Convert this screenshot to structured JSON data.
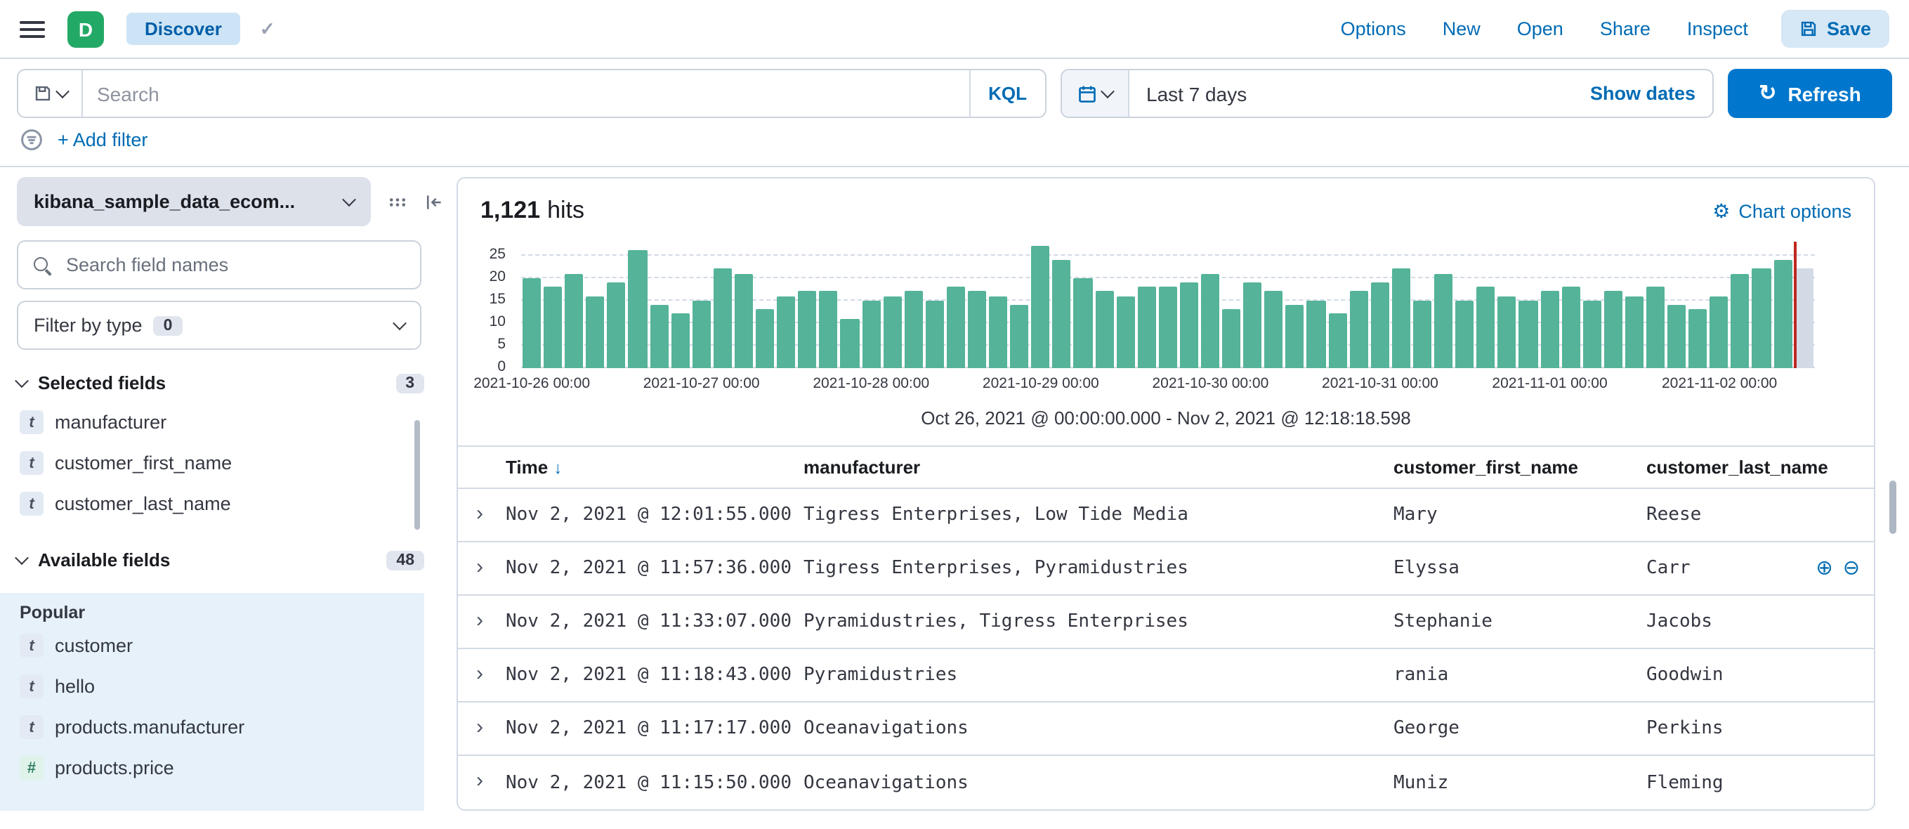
{
  "header": {
    "logo_letter": "D",
    "breadcrumb": "Discover",
    "nav_links": [
      "Options",
      "New",
      "Open",
      "Share",
      "Inspect"
    ],
    "save_label": "Save"
  },
  "search_bar": {
    "placeholder": "Search",
    "kql_label": "KQL",
    "time_range": "Last 7 days",
    "show_dates_label": "Show dates",
    "refresh_label": "Refresh"
  },
  "filter_bar": {
    "add_filter_label": "+ Add filter"
  },
  "sidebar": {
    "index_pattern": "kibana_sample_data_ecom...",
    "field_search_placeholder": "Search field names",
    "filter_by_type_label": "Filter by type",
    "filter_by_type_count": "0",
    "selected_fields": {
      "label": "Selected fields",
      "count": "3",
      "items": [
        {
          "type": "t",
          "name": "manufacturer"
        },
        {
          "type": "t",
          "name": "customer_first_name"
        },
        {
          "type": "t",
          "name": "customer_last_name"
        }
      ]
    },
    "available_fields": {
      "label": "Available fields",
      "count": "48",
      "popular_label": "Popular",
      "items": [
        {
          "type": "t",
          "name": "customer"
        },
        {
          "type": "t",
          "name": "hello"
        },
        {
          "type": "t",
          "name": "products.manufacturer"
        },
        {
          "type": "#",
          "name": "products.price"
        }
      ]
    }
  },
  "results": {
    "hits_count": "1,121",
    "hits_label": "hits",
    "chart_options_label": "Chart options",
    "time_range_caption": "Oct 26, 2021 @ 00:00:00.000 - Nov 2, 2021 @ 12:18:18.598"
  },
  "chart_data": {
    "type": "bar",
    "title": "Discover hits histogram",
    "x_labels": [
      "2021-10-26 00:00",
      "2021-10-27 00:00",
      "2021-10-28 00:00",
      "2021-10-29 00:00",
      "2021-10-30 00:00",
      "2021-10-31 00:00",
      "2021-11-01 00:00",
      "2021-11-02 00:00"
    ],
    "bars_per_label": 8,
    "values": [
      20,
      18,
      21,
      16,
      19,
      26,
      14,
      12,
      15,
      22,
      21,
      13,
      16,
      17,
      17,
      11,
      15,
      16,
      17,
      15,
      18,
      17,
      16,
      14,
      27,
      24,
      20,
      17,
      16,
      18,
      18,
      19,
      21,
      13,
      19,
      17,
      14,
      15,
      12,
      17,
      19,
      22,
      15,
      21,
      15,
      18,
      16,
      15,
      17,
      18,
      15,
      17,
      16,
      18,
      14,
      13,
      16,
      21,
      22,
      24
    ],
    "partial_bucket_value": 22,
    "yticks": [
      0,
      5,
      10,
      15,
      20,
      25
    ],
    "ylim": [
      0,
      28
    ],
    "bar_color": "#54B399",
    "partial_bar_color": "#D3DAE6",
    "now_marker_color": "#BD271E",
    "grid": true
  },
  "table": {
    "columns": [
      "Time",
      "manufacturer",
      "customer_first_name",
      "customer_last_name"
    ],
    "rows": [
      {
        "time": "Nov 2, 2021 @ 12:01:55.000",
        "manufacturer": "Tigress Enterprises, Low Tide Media",
        "customer_first_name": "Mary",
        "customer_last_name": "Reese",
        "show_actions": false
      },
      {
        "time": "Nov 2, 2021 @ 11:57:36.000",
        "manufacturer": "Tigress Enterprises, Pyramidustries",
        "customer_first_name": "Elyssa",
        "customer_last_name": "Carr",
        "show_actions": true
      },
      {
        "time": "Nov 2, 2021 @ 11:33:07.000",
        "manufacturer": "Pyramidustries, Tigress Enterprises",
        "customer_first_name": "Stephanie",
        "customer_last_name": "Jacobs",
        "show_actions": false
      },
      {
        "time": "Nov 2, 2021 @ 11:18:43.000",
        "manufacturer": "Pyramidustries",
        "customer_first_name": "rania",
        "customer_last_name": "Goodwin",
        "show_actions": false
      },
      {
        "time": "Nov 2, 2021 @ 11:17:17.000",
        "manufacturer": "Oceanavigations",
        "customer_first_name": "George",
        "customer_last_name": "Perkins",
        "show_actions": false
      },
      {
        "time": "Nov 2, 2021 @ 11:15:50.000",
        "manufacturer": "Oceanavigations",
        "customer_first_name": "Muniz",
        "customer_last_name": "Fleming",
        "show_actions": false
      }
    ]
  },
  "icons": {
    "check": "✓",
    "refresh": "↻",
    "gear": "⚙",
    "sort_desc": "↓",
    "expand": "›",
    "filter_for": "⊕",
    "filter_out": "⊖"
  },
  "colors": {
    "primary_link": "#006BB4",
    "primary_button": "#0077CC",
    "logo_green": "#23A966",
    "border": "#D3DAE6",
    "popular_bg": "#E6F1FA"
  }
}
